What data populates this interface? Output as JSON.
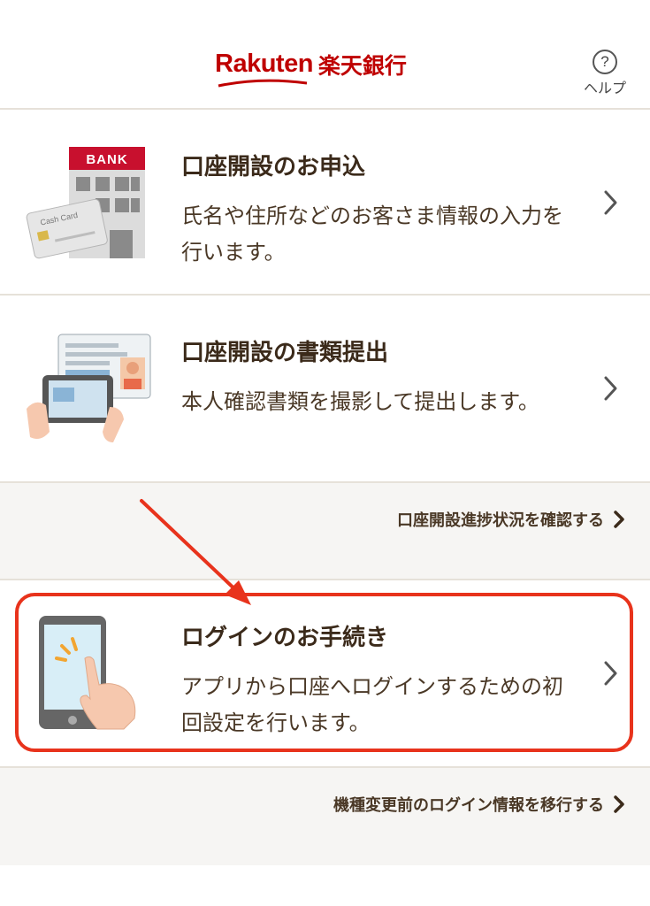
{
  "header": {
    "logo_text": "Rakuten",
    "logo_bank": "楽天銀行",
    "help_icon_glyph": "?",
    "help_label": "ヘルプ"
  },
  "cards": [
    {
      "title": "口座開設のお申込",
      "description": "氏名や住所などのお客さま情報の入力を行います。",
      "illustration": "bank-building-with-cash-card",
      "bank_sign": "BANK",
      "card_label": "Cash Card"
    },
    {
      "title": "口座開設の書類提出",
      "description": "本人確認書類を撮影して提出します。",
      "illustration": "phone-photographing-id-card"
    },
    {
      "title": "ログインのお手続き",
      "description": "アプリから口座へログインするための初回設定を行います。",
      "illustration": "finger-tapping-smartphone"
    }
  ],
  "links": {
    "progress": "口座開設進捗状況を確認する",
    "transfer": "機種変更前のログイン情報を移行する"
  },
  "colors": {
    "brand_red": "#bf0000",
    "highlight_red": "#e8331c",
    "text_brown": "#3b2a1a",
    "divider": "#e6e1d9",
    "gray_band": "#f6f5f3"
  }
}
